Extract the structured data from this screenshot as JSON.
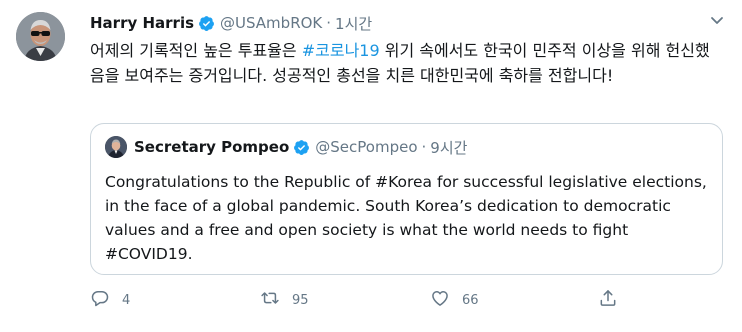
{
  "tweet": {
    "author_name": "Harry Harris",
    "author_handle": "@USAmbROK",
    "separator": "·",
    "time": "1시간",
    "text_before": "어제의 기록적인 높은 투표율은 ",
    "hashtag": "#코로나19",
    "text_after": " 위기 속에서도 한국이 민주적 이상을 위해 헌신했음을 보여주는 증거입니다. 성공적인 총선을 치른 대한민국에 축하를 전합니다!"
  },
  "quote": {
    "author_name": "Secretary Pompeo",
    "author_handle": "@SecPompeo",
    "separator": "·",
    "time": "9시간",
    "text": "Congratulations to the Republic of #Korea for successful legislative elections, in the face of a global pandemic. South Korea’s dedication to democratic values and a free and open society is what the world needs to fight #COVID19."
  },
  "actions": {
    "reply_count": "4",
    "retweet_count": "95",
    "like_count": "66"
  },
  "icons": {
    "verified": "verified-badge-icon",
    "chevron": "chevron-down-icon",
    "reply": "reply-icon",
    "retweet": "retweet-icon",
    "like": "heart-icon",
    "share": "share-icon"
  },
  "colors": {
    "link": "#1b95e0",
    "secondary_text": "#657786",
    "verified_blue": "#1da1f2",
    "border": "#ccd6dd"
  }
}
